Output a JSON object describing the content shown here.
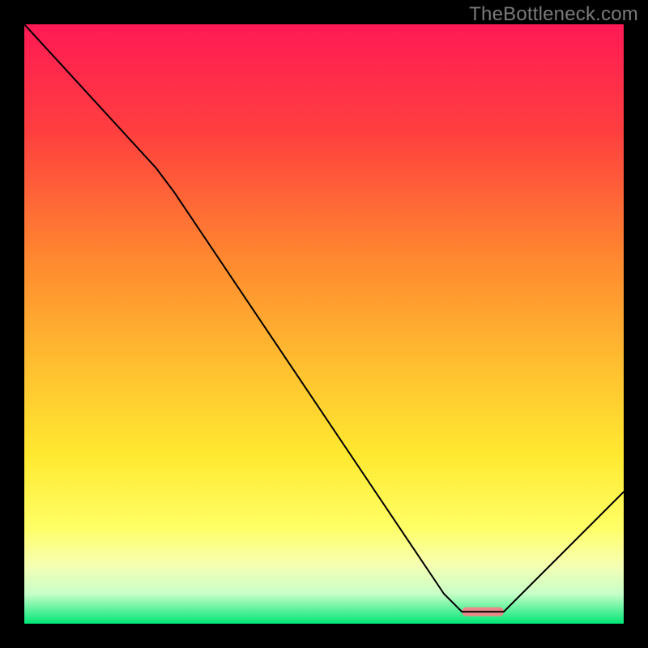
{
  "watermark": "TheBottleneck.com",
  "chart_data": {
    "type": "line",
    "title": "",
    "xlabel": "",
    "ylabel": "",
    "xlim": [
      0,
      100
    ],
    "ylim": [
      0,
      100
    ],
    "grid": false,
    "legend_position": "none",
    "background": {
      "type": "vertical-gradient",
      "stops": [
        {
          "offset": 0.0,
          "color": "#ff1a55"
        },
        {
          "offset": 0.18,
          "color": "#ff3f3f"
        },
        {
          "offset": 0.4,
          "color": "#ff8b2f"
        },
        {
          "offset": 0.58,
          "color": "#ffc230"
        },
        {
          "offset": 0.72,
          "color": "#ffe930"
        },
        {
          "offset": 0.84,
          "color": "#ffff66"
        },
        {
          "offset": 0.9,
          "color": "#f7ffb0"
        },
        {
          "offset": 0.95,
          "color": "#c8ffc8"
        },
        {
          "offset": 1.0,
          "color": "#00e676"
        }
      ]
    },
    "series": [
      {
        "name": "bottleneck-curve",
        "color": "#000000",
        "width": 2,
        "points": [
          {
            "x": 0,
            "y": 100
          },
          {
            "x": 22,
            "y": 76
          },
          {
            "x": 25,
            "y": 72
          },
          {
            "x": 70,
            "y": 5
          },
          {
            "x": 73,
            "y": 2
          },
          {
            "x": 80,
            "y": 2
          },
          {
            "x": 100,
            "y": 22
          }
        ]
      }
    ],
    "annotations": [
      {
        "name": "optimal-marker",
        "type": "rounded-bar",
        "color": "#e88a8a",
        "x_start": 73,
        "x_end": 80,
        "y": 2,
        "height_pct": 1.5
      }
    ]
  }
}
